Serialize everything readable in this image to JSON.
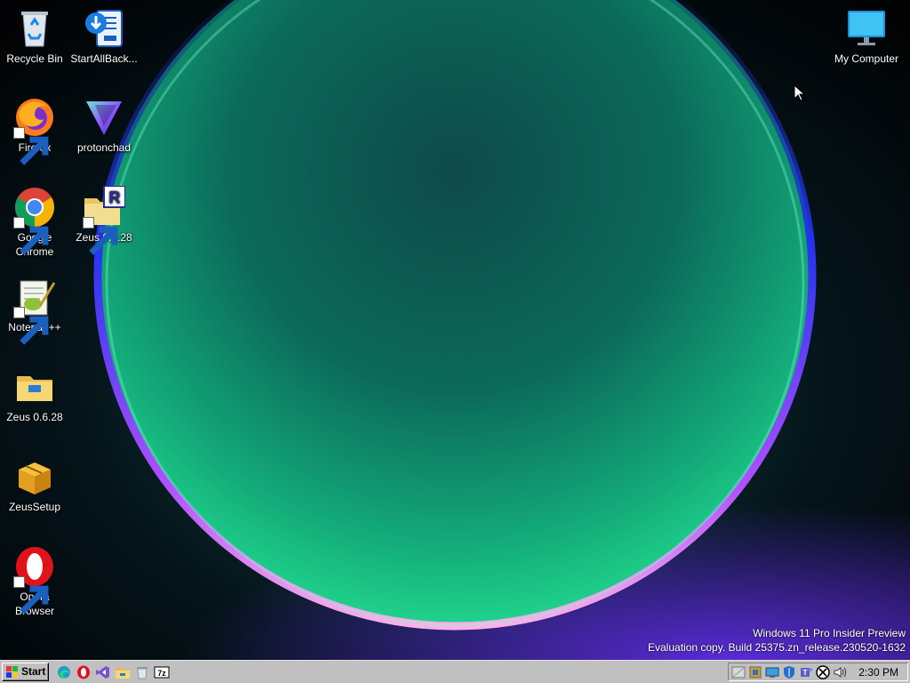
{
  "desktop": {
    "icons": [
      {
        "label": "Recycle Bin",
        "icon": "recycle-bin-icon"
      },
      {
        "label": "StartAllBack...",
        "icon": "startallback-icon"
      },
      {
        "label": "Firefox",
        "icon": "firefox-icon"
      },
      {
        "label": "protonchad",
        "icon": "protonvpn-icon"
      },
      {
        "label": "Google Chrome",
        "icon": "chrome-icon"
      },
      {
        "label": "Zeus 0.6.28",
        "icon": "zeus-archive-folder-icon"
      },
      {
        "label": "Notepad++",
        "icon": "notepadpp-icon"
      },
      {
        "label": "Zeus 0.6.28",
        "icon": "folder-icon"
      },
      {
        "label": "ZeusSetup",
        "icon": "setup-box-icon"
      },
      {
        "label": "Opera Browser",
        "icon": "opera-icon"
      },
      {
        "label": "My Computer",
        "icon": "monitor-icon"
      }
    ],
    "watermark": {
      "line1": "Windows 11 Pro Insider Preview",
      "line2": "Evaluation copy. Build 25375.zn_release.230520-1632"
    }
  },
  "taskbar": {
    "start_label": "Start",
    "quick_launch": [
      "edge-icon",
      "opera-icon",
      "visual-studio-icon",
      "explorer-icon",
      "recycle-icon",
      "7zip-icon"
    ],
    "tray_icons": [
      "network-icon",
      "app-icon",
      "display-icon",
      "defender-icon",
      "teams-icon",
      "xbox-icon",
      "volume-icon"
    ],
    "clock": "2:30 PM"
  },
  "colors": {
    "taskbar": "#c0c0c0",
    "wallpaper_glow": "#1fd18a",
    "wallpaper_ring": "#6b3cff"
  }
}
